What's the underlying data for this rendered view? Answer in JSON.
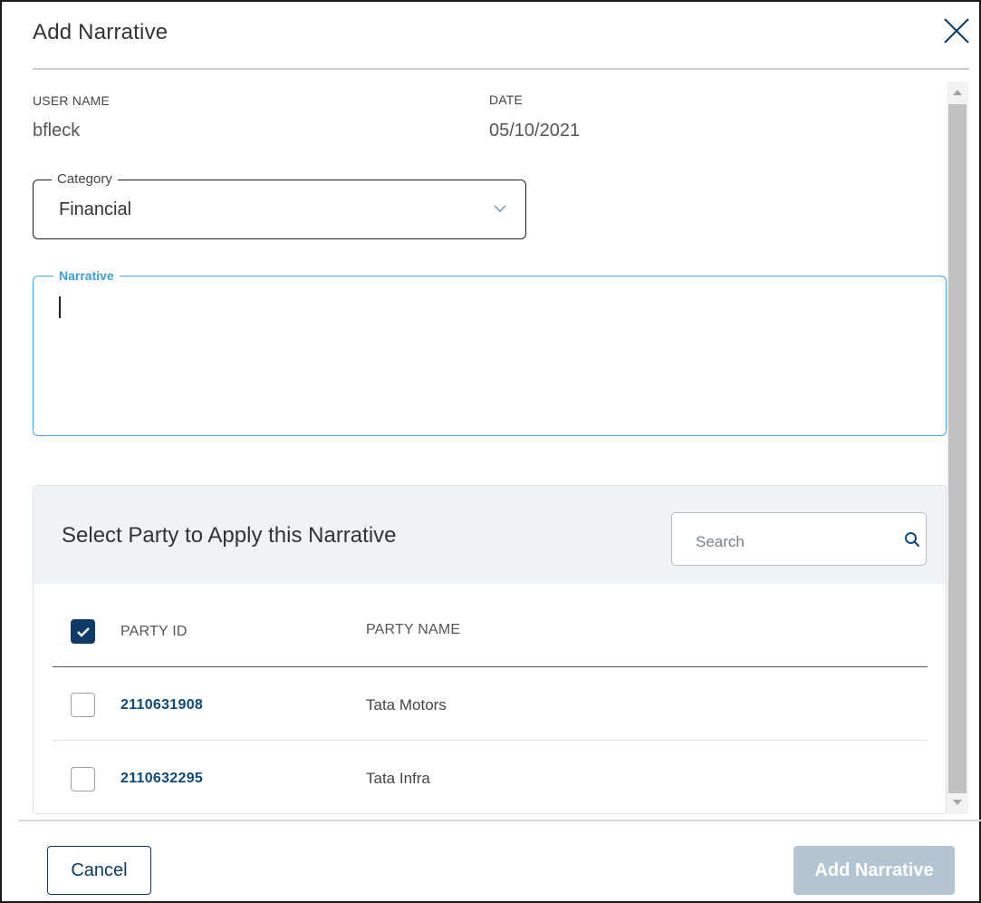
{
  "dialog": {
    "title": "Add Narrative",
    "close_icon": "close-icon"
  },
  "meta": {
    "user_name_label": "USER NAME",
    "user_name_value": "bfleck",
    "date_label": "DATE",
    "date_value": "05/10/2021"
  },
  "category": {
    "label": "Category",
    "value": "Financial",
    "icon": "chevron-down-icon"
  },
  "narrative": {
    "label": "Narrative",
    "value": ""
  },
  "party_panel": {
    "title": "Select Party to Apply this Narrative",
    "search_placeholder": "Search",
    "search_icon": "search-icon",
    "columns": [
      "PARTY ID",
      "PARTY NAME"
    ],
    "select_all_checked": true,
    "rows": [
      {
        "party_id": "2110631908",
        "party_name": "Tata Motors",
        "checked": false
      },
      {
        "party_id": "2110632295",
        "party_name": "Tata Infra",
        "checked": false
      }
    ]
  },
  "footer": {
    "cancel_label": "Cancel",
    "submit_label": "Add Narrative"
  },
  "colors": {
    "primary": "#0d3a66",
    "focus_blue": "#3a9fd8",
    "disabled_button": "#b3c5d3",
    "panel_header_bg": "#f0f3f6"
  }
}
